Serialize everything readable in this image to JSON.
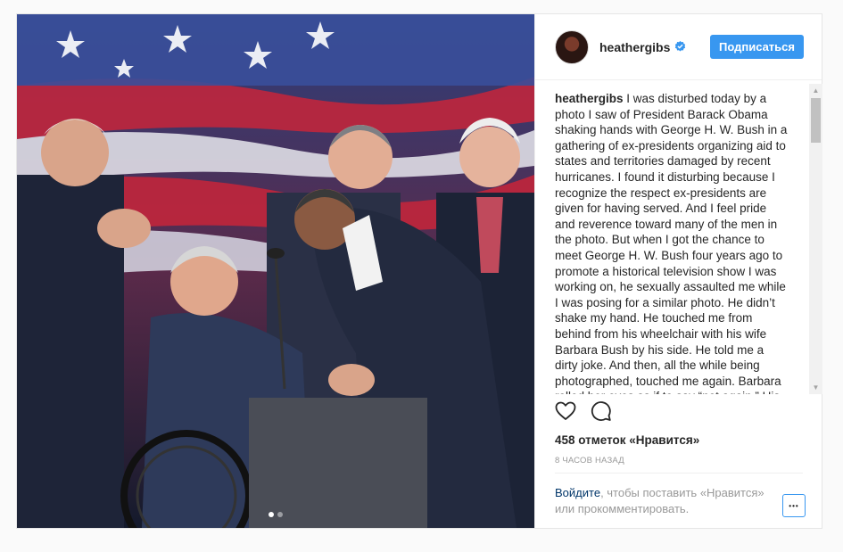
{
  "post": {
    "username": "heathergibs",
    "verified": true,
    "follow_label": "Подписаться",
    "caption_username": "heathergibs",
    "caption_text": "I was disturbed today by a photo I saw of President Barack Obama shaking hands with George H. W. Bush in a gathering of ex-presidents organizing aid to states and territories damaged by recent hurricanes. I found it disturbing because I recognize the respect ex-presidents are given for having served. And I feel pride and reverence toward many of the men in the photo. But when I got the chance to meet George H. W. Bush four years ago to promote a historical television show I was working on, he sexually assaulted me while I was posing for a similar photo. He didn’t shake my hand. He touched me from behind from his wheelchair with his wife Barbara Bush by his side. He told me a dirty joke. And then, all the while being photographed, touched me again. Barbara rolled her eyes as if to say “not again.” His",
    "likes_text": "458 отметок «Нравится»",
    "time_text": "8 часов назад",
    "login_link": "Войдите",
    "login_rest": ", чтобы поставить «Нравится» или прокомментировать.",
    "more_label": "•••",
    "carousel": {
      "total": 2,
      "active": 1
    }
  },
  "icons": {
    "like": "heart-icon",
    "comment": "comment-icon",
    "verified": "verified-badge-icon"
  },
  "colors": {
    "accent": "#3897f0",
    "link": "#003569",
    "muted": "#999999"
  }
}
